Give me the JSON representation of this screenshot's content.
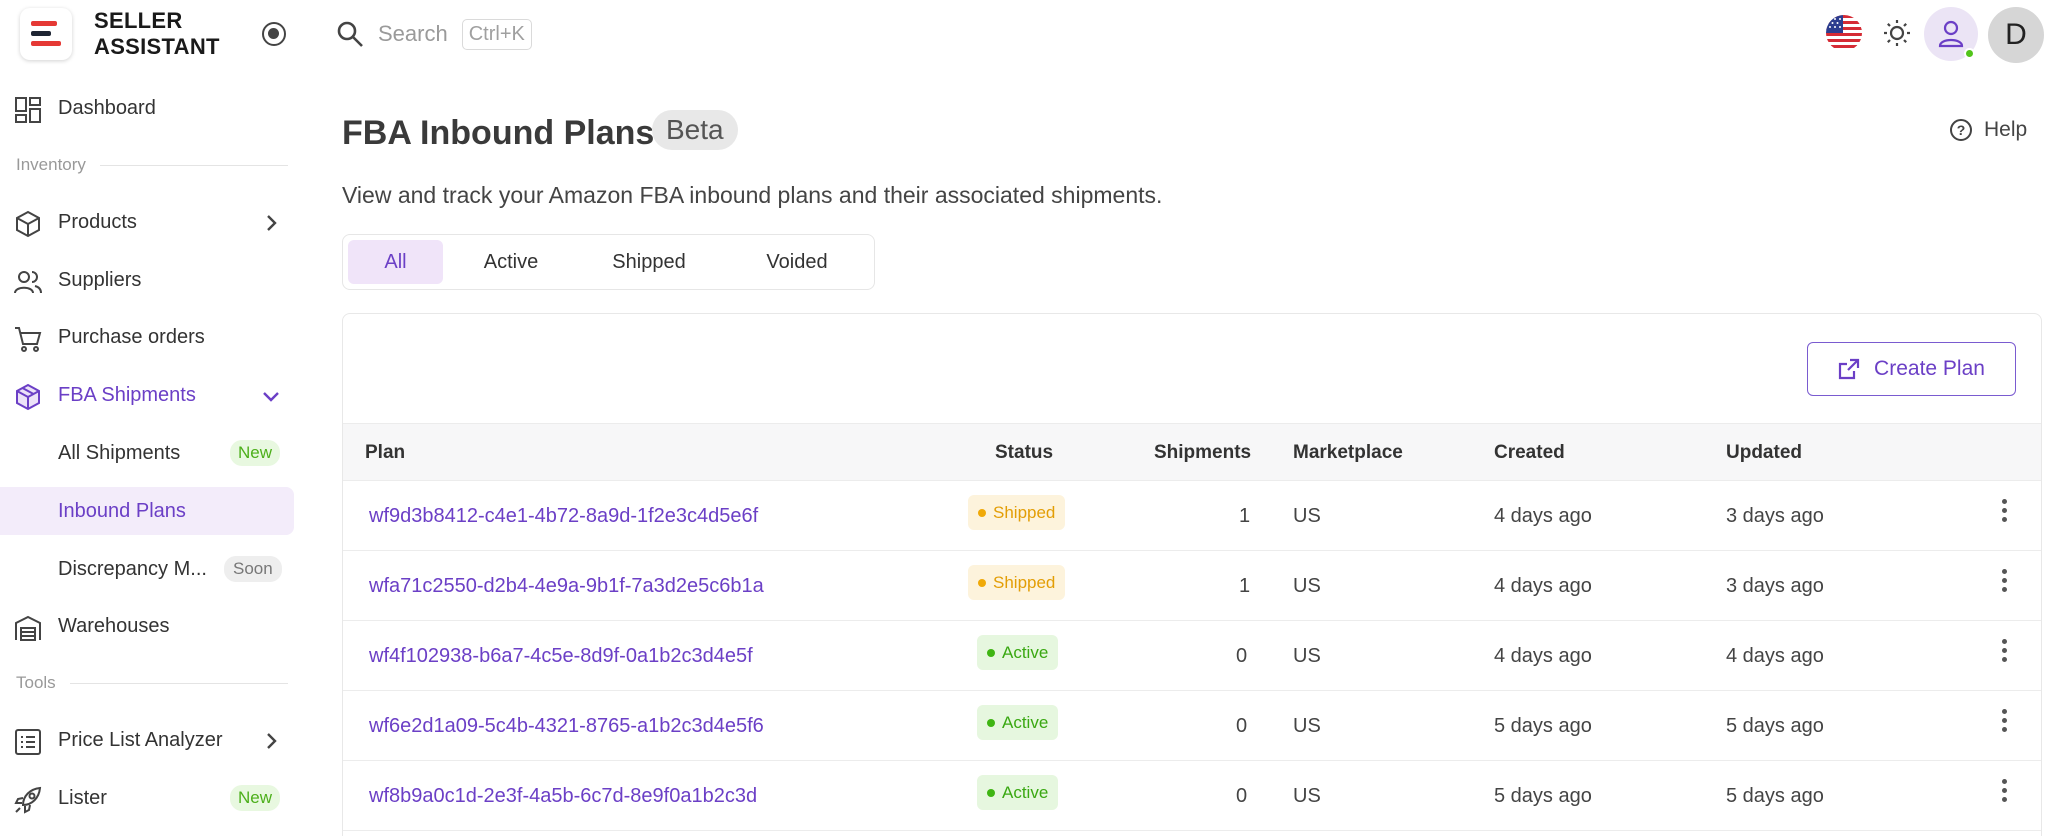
{
  "brand": {
    "line1": "SELLER",
    "line2": "ASSISTANT",
    "colors": [
      "#e53935",
      "#1e2533",
      "#e53935"
    ]
  },
  "sidebar": {
    "dashboard": "Dashboard",
    "section_inventory": "Inventory",
    "products": "Products",
    "suppliers": "Suppliers",
    "purchase_orders": "Purchase orders",
    "fba_shipments": "FBA Shipments",
    "all_shipments": "All Shipments",
    "badge_new": "New",
    "inbound_plans": "Inbound Plans",
    "discrepancy": "Discrepancy M...",
    "badge_soon": "Soon",
    "warehouses": "Warehouses",
    "section_tools": "Tools",
    "price_list_analyzer": "Price List Analyzer",
    "lister": "Lister"
  },
  "topbar": {
    "search_label": "Search",
    "search_shortcut": "Ctrl+K",
    "avatar_initial": "D",
    "locale_icon": "us-flag-icon",
    "theme_icon": "sun-icon",
    "online_color": "#52c41a"
  },
  "page": {
    "title": "FBA Inbound Plans",
    "beta": "Beta",
    "help": "Help",
    "subtitle": "View and track your Amazon FBA inbound plans and their associated shipments."
  },
  "tabs": [
    "All",
    "Active",
    "Shipped",
    "Voided"
  ],
  "active_tab": "All",
  "create_button": "Create Plan",
  "table": {
    "headers": {
      "plan": "Plan",
      "status": "Status",
      "shipments": "Shipments",
      "marketplace": "Marketplace",
      "created": "Created",
      "updated": "Updated"
    },
    "rows": [
      {
        "plan": "wf9d3b8412-c4e1-4b72-8a9d-1f2e3c4d5e6f",
        "status": "Shipped",
        "shipments": "1",
        "marketplace": "US",
        "created": "4 days ago",
        "updated": "3 days ago"
      },
      {
        "plan": "wfa71c2550-d2b4-4e9a-9b1f-7a3d2e5c6b1a",
        "status": "Shipped",
        "shipments": "1",
        "marketplace": "US",
        "created": "4 days ago",
        "updated": "3 days ago"
      },
      {
        "plan": "wf4f102938-b6a7-4c5e-8d9f-0a1b2c3d4e5f",
        "status": "Active",
        "shipments": "0",
        "marketplace": "US",
        "created": "4 days ago",
        "updated": "4 days ago"
      },
      {
        "plan": "wf6e2d1a09-5c4b-4321-8765-a1b2c3d4e5f6",
        "status": "Active",
        "shipments": "0",
        "marketplace": "US",
        "created": "5 days ago",
        "updated": "5 days ago"
      },
      {
        "plan": "wf8b9a0c1d-2e3f-4a5b-6c7d-8e9f0a1b2c3d",
        "status": "Active",
        "shipments": "0",
        "marketplace": "US",
        "created": "5 days ago",
        "updated": "5 days ago"
      }
    ]
  },
  "colors": {
    "accent": "#6b3fc6",
    "shipped": "#e39e06",
    "active": "#3aa812"
  }
}
